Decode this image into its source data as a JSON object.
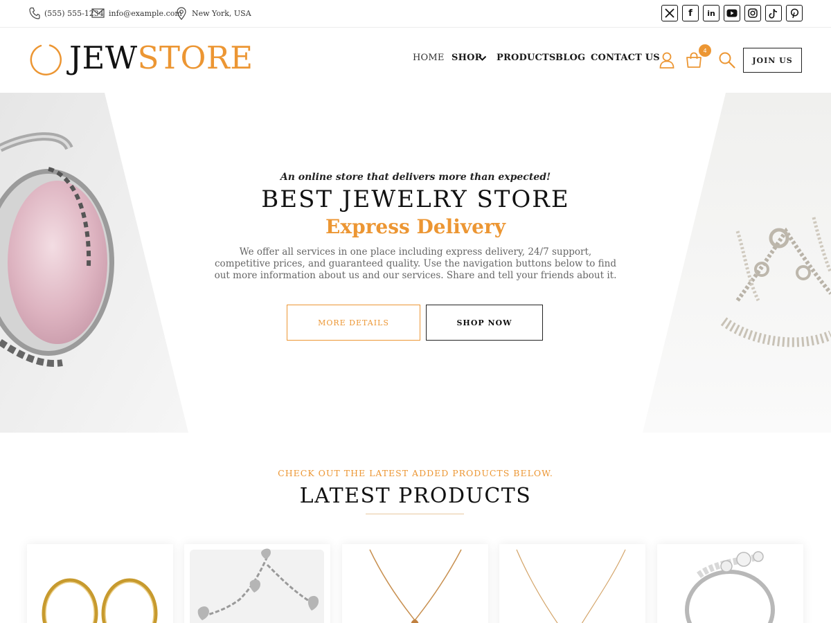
{
  "topbar": {
    "phone": "(555) 555-1234",
    "email": "info@example.com",
    "location": "New York, USA",
    "social_icons": [
      "x-icon",
      "facebook-icon",
      "linkedin-icon",
      "youtube-icon",
      "instagram-icon",
      "tiktok-icon",
      "pinterest-icon"
    ]
  },
  "logo": {
    "part1": "JEW",
    "part2": "STORE"
  },
  "nav": {
    "items": [
      {
        "label": "HOME"
      },
      {
        "label": "SHOP"
      },
      {
        "label": "PRODUCTS"
      },
      {
        "label": "BLOG"
      },
      {
        "label": "CONTACT US"
      }
    ],
    "cart_count": "4",
    "join_label": "JOIN US"
  },
  "hero": {
    "tagline": "An online store that delivers more than expected!",
    "title": "BEST JEWELRY STORE",
    "subtitle": "Express Delivery",
    "description": "We offer all services in one place including express delivery, 24/7 support, competitive prices, and guaranteed quality. Use the navigation buttons below to find out more information about us and our services. Share and tell your friends about it.",
    "more_label": "MORE DETAILS",
    "shop_label": "SHOP NOW"
  },
  "latest": {
    "kicker": "CHECK OUT THE LATEST ADDED PRODUCTS BELOW.",
    "title": "LATEST PRODUCTS"
  },
  "colors": {
    "accent": "#ec9633",
    "dark": "#111111",
    "muted": "#666666"
  }
}
